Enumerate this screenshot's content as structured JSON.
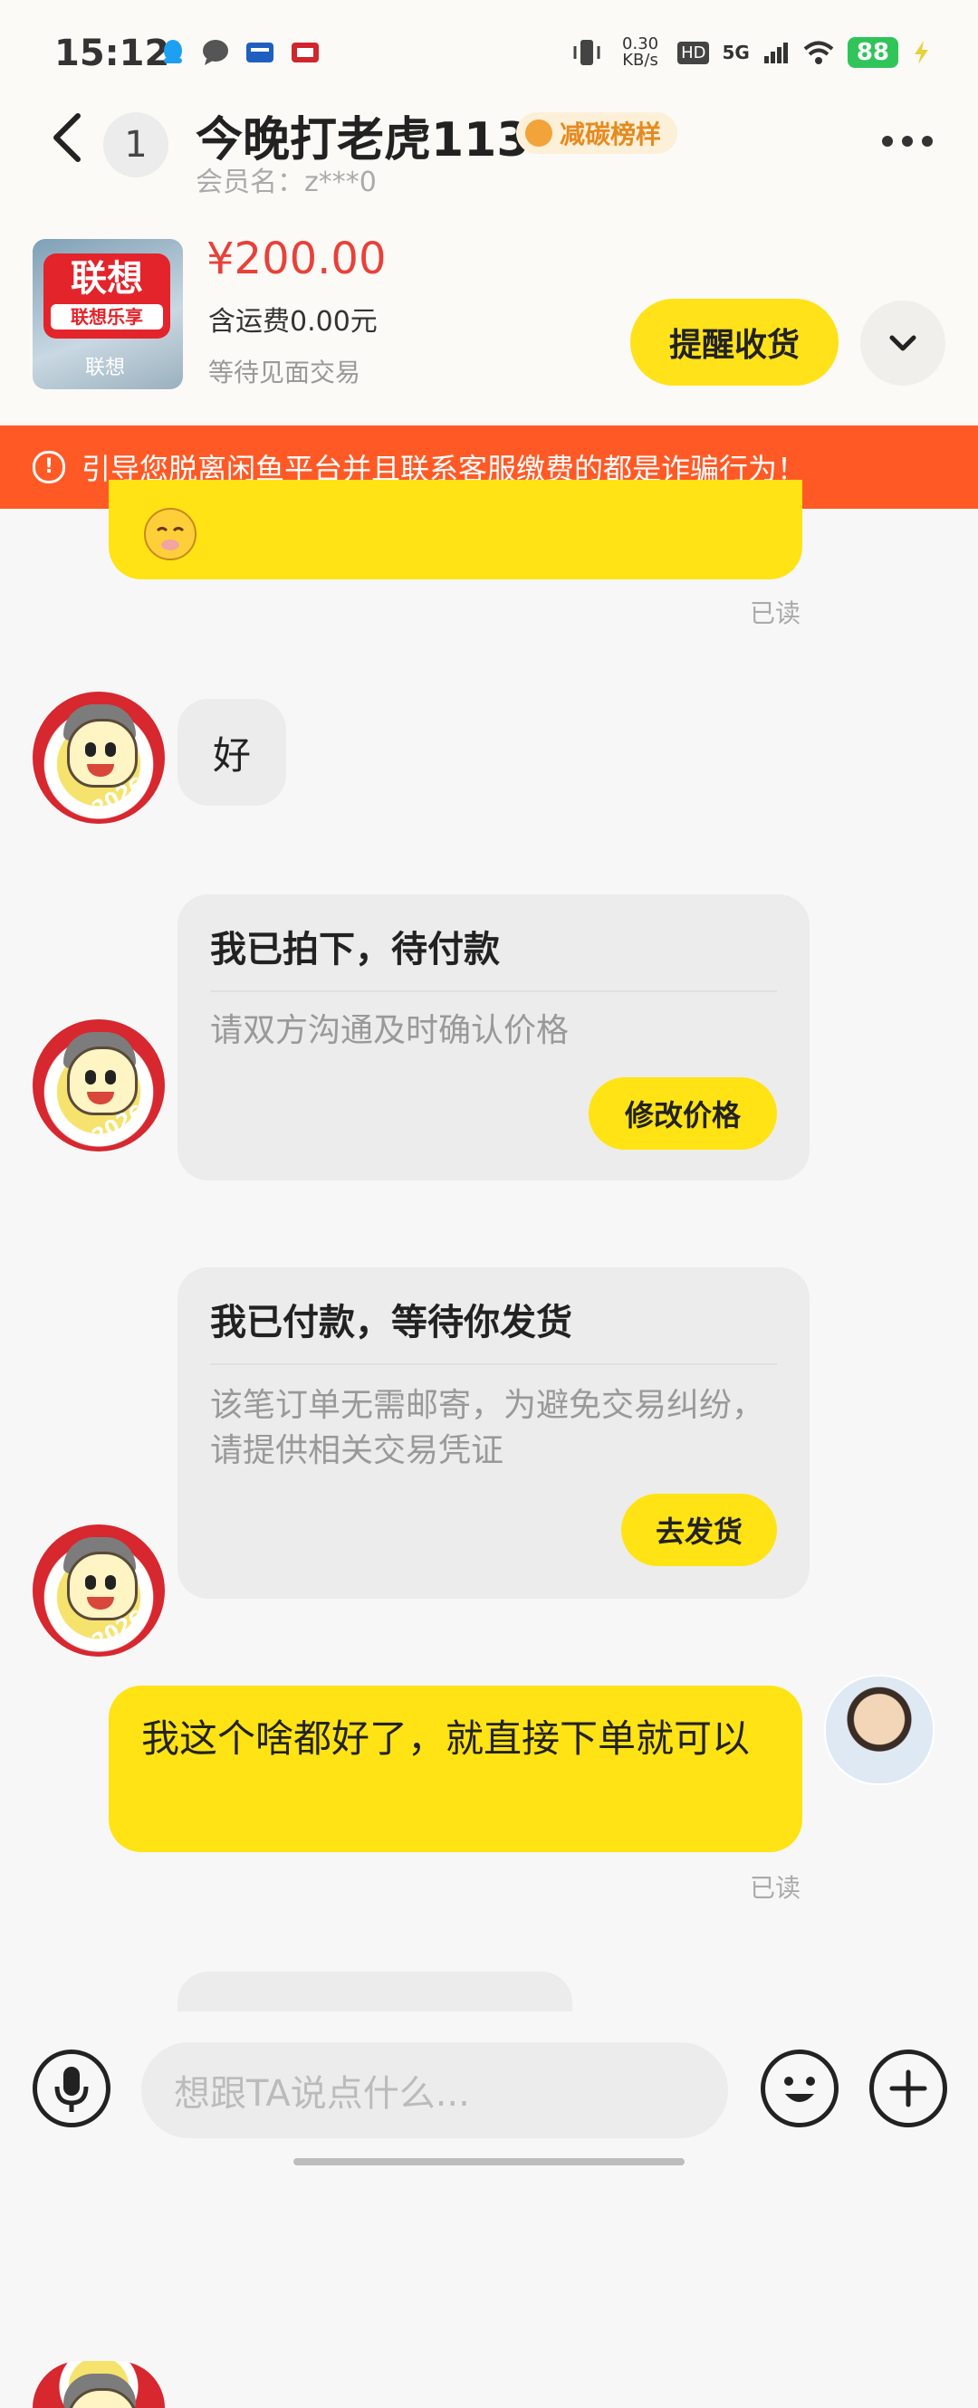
{
  "status_bar": {
    "time": "15:12",
    "net_speed": "0.30 KB/s",
    "hd": "HD",
    "network": "5G",
    "battery": "88",
    "icons": [
      "qq-icon",
      "message-icon",
      "news-icon",
      "tv-icon",
      "vibrate-icon",
      "signal-icon",
      "wifi-icon",
      "battery-icon",
      "charging-icon"
    ]
  },
  "header": {
    "unread_count": "1",
    "title": "今晚打老虎113",
    "badge": "减碳榜样",
    "member_label": "会员名：z***0"
  },
  "product": {
    "logo_text": "联想",
    "logo_sub": "联想乐享",
    "logo_mark": "联想",
    "price": "¥200.00",
    "shipping": "含运费0.00元",
    "status": "等待见面交易",
    "remind_button": "提醒收货"
  },
  "warning": {
    "text": "引导您脱离闲鱼平台并且联系客服缴费的都是诈骗行为！"
  },
  "messages": {
    "read_1": "已读",
    "reply_good": "好",
    "card1": {
      "title": "我已拍下，待付款",
      "desc": "请双方沟通及时确认价格",
      "button": "修改价格"
    },
    "card2": {
      "title": "我已付款，等待你发货",
      "desc": "该笔订单无需邮寄，为避免交易纠纷，请提供相关交易凭证",
      "button": "去发货"
    },
    "my_message": "我这个啥都好了，就直接下单就可以",
    "read_2": "已读"
  },
  "input_bar": {
    "placeholder": "想跟TA说点什么..."
  },
  "colors": {
    "accent_yellow": "#ffe314",
    "price_red": "#e8413a",
    "warning_orange": "#ff5a26"
  }
}
